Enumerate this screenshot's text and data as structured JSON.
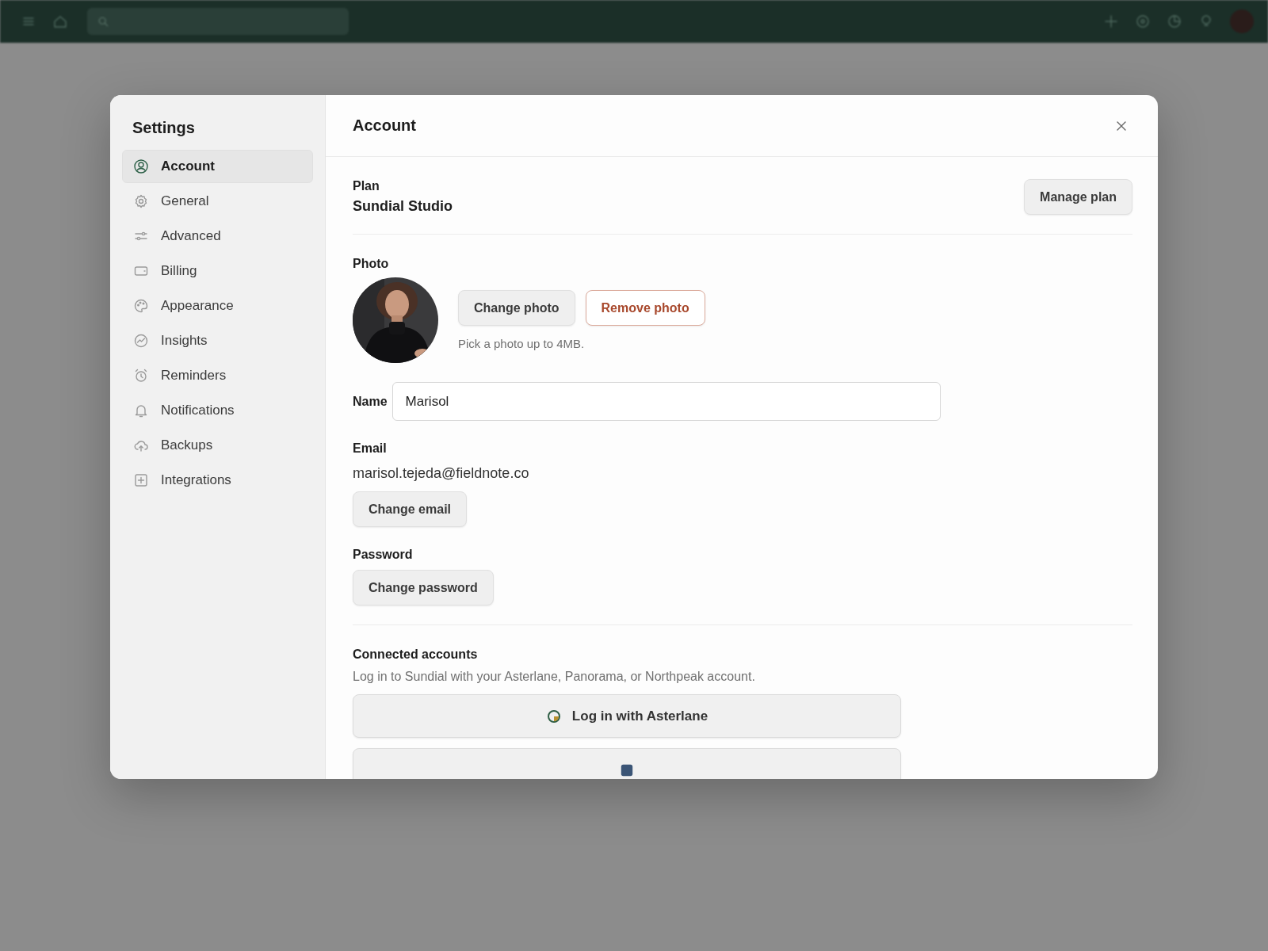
{
  "settings": {
    "title": "Settings",
    "nav": [
      {
        "label": "Account",
        "selected": true
      },
      {
        "label": "General",
        "selected": false
      },
      {
        "label": "Advanced",
        "selected": false
      },
      {
        "label": "Billing",
        "selected": false
      },
      {
        "label": "Appearance",
        "selected": false
      },
      {
        "label": "Insights",
        "selected": false
      },
      {
        "label": "Reminders",
        "selected": false
      },
      {
        "label": "Notifications",
        "selected": false
      },
      {
        "label": "Backups",
        "selected": false
      },
      {
        "label": "Integrations",
        "selected": false
      }
    ]
  },
  "header": {
    "title": "Account"
  },
  "plan": {
    "label": "Plan",
    "value": "Sundial Studio",
    "button": "Manage plan"
  },
  "photo": {
    "label": "Photo",
    "kind": "picture",
    "buttons": [
      {
        "label": "Change photo",
        "kind": "default"
      },
      {
        "label": "Remove photo",
        "kind": "danger"
      }
    ],
    "hint": "Pick a photo up to 4MB."
  },
  "name": {
    "label": "Name",
    "value": "Marisol"
  },
  "email": {
    "label": "Email",
    "value": "marisol.tejeda@fieldnote.co",
    "button": "Change email"
  },
  "password": {
    "label": "Password",
    "button": "Change password"
  },
  "connected": {
    "title": "Connected accounts",
    "description": "Log in to Sundial with your Asterlane, Panorama, or Northpeak account.",
    "providers": [
      {
        "label": "Log in with Asterlane",
        "kind": "asterlane"
      },
      {
        "kind": "panorama"
      }
    ]
  }
}
